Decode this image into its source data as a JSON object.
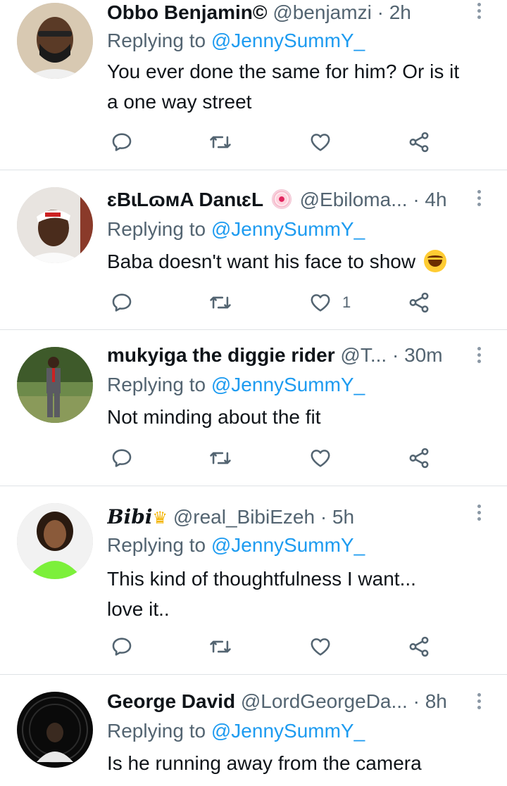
{
  "reply_prefix": "Replying to",
  "tweets": [
    {
      "name": "Obbo Benjamin©",
      "handle": "@benjamzi",
      "time": "2h",
      "replying_to": "@JennySummY_",
      "text_lines": [
        "You ever done the same for him? Or is it",
        "a one way street"
      ],
      "like_count": ""
    },
    {
      "name": "ɛBɩLɷмA DanɩɛL",
      "handle": "@Ebiloma...",
      "time": "4h",
      "replying_to": "@JennySummY_",
      "text_lines": [
        "Baba doesn't want his face to show"
      ],
      "like_count": "1"
    },
    {
      "name": "mukyiga the diggie rider",
      "handle": "@T...",
      "time": "30m",
      "replying_to": "@JennySummY_",
      "text_lines": [
        "Not minding about the fit"
      ],
      "like_count": ""
    },
    {
      "name": "Bibi",
      "handle": "@real_BibiEzeh",
      "time": "5h",
      "replying_to": "@JennySummY_",
      "text_lines": [
        "This kind of thoughtfulness I want...",
        "love it.."
      ],
      "like_count": ""
    },
    {
      "name": "George David",
      "handle": "@LordGeorgeDa...",
      "time": "8h",
      "replying_to": "@JennySummY_",
      "text_lines": [
        "Is he running away from the camera"
      ],
      "like_count": ""
    }
  ],
  "colors": {
    "accent": "#1d9bf0",
    "secondary_text": "#536471",
    "primary_text": "#0f1419",
    "icon": "#536471",
    "divider": "#dfe3e6"
  },
  "icons": {
    "reply": "reply-icon",
    "retweet": "retweet-icon",
    "like": "heart-icon",
    "share": "share-icon",
    "more": "more-vertical-icon"
  }
}
